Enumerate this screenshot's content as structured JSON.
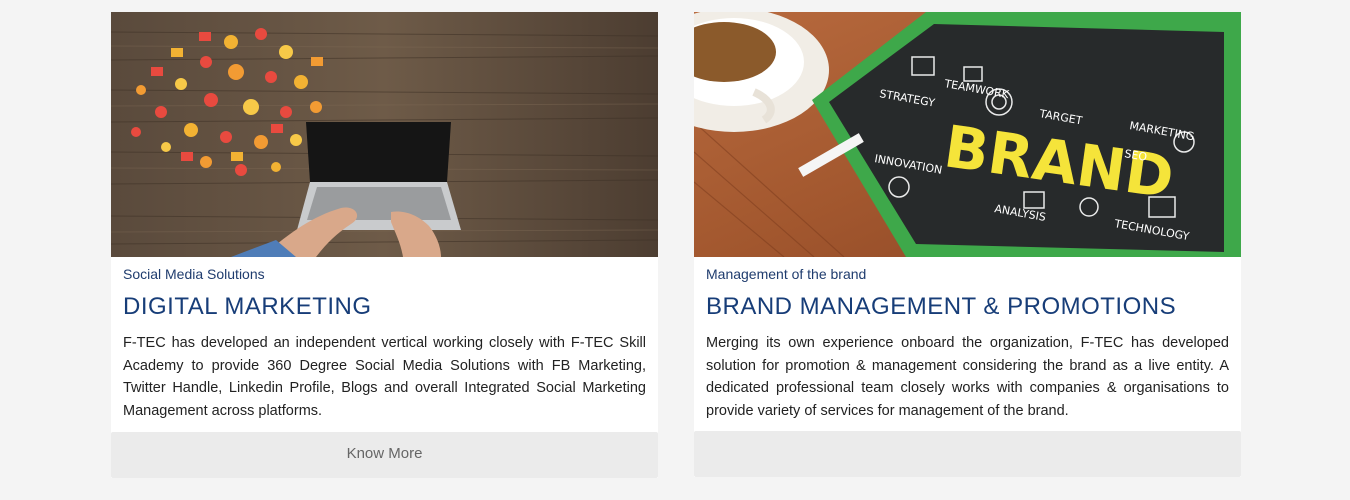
{
  "cards": [
    {
      "image_icon": "social-media-laptop-image",
      "kicker": "Social Media Solutions",
      "title": "DIGITAL MARKETING",
      "description": "F-TEC has developed an independent vertical working closely with F-TEC Skill Academy to provide 360 Degree Social Media Solutions with FB Marketing, Twitter Handle, Linkedin Profile, Blogs and overall Integrated Social Marketing Management across platforms.",
      "button_label": "Know More"
    },
    {
      "image_icon": "brand-chalkboard-image",
      "kicker": "Management of the brand",
      "title": "BRAND MANAGEMENT & PROMOTIONS",
      "description": "Merging its own experience onboard the organization, F-TEC has developed solution for promotion & management considering the brand as a live entity. A dedicated professional team closely works with companies & organisations to provide variety of services for management of the brand.",
      "button_label": "",
      "chalkboard_words": [
        "BRAND",
        "STRATEGY",
        "TARGET",
        "MARKETING",
        "INNOVATION",
        "SEO",
        "ANALYSIS",
        "TECHNOLOGY",
        "TEAMWORK"
      ]
    }
  ],
  "colors": {
    "title": "#173d78",
    "kicker": "#1f3c6e",
    "button_bg": "#ebebeb",
    "page_bg": "#f4f4f4"
  }
}
